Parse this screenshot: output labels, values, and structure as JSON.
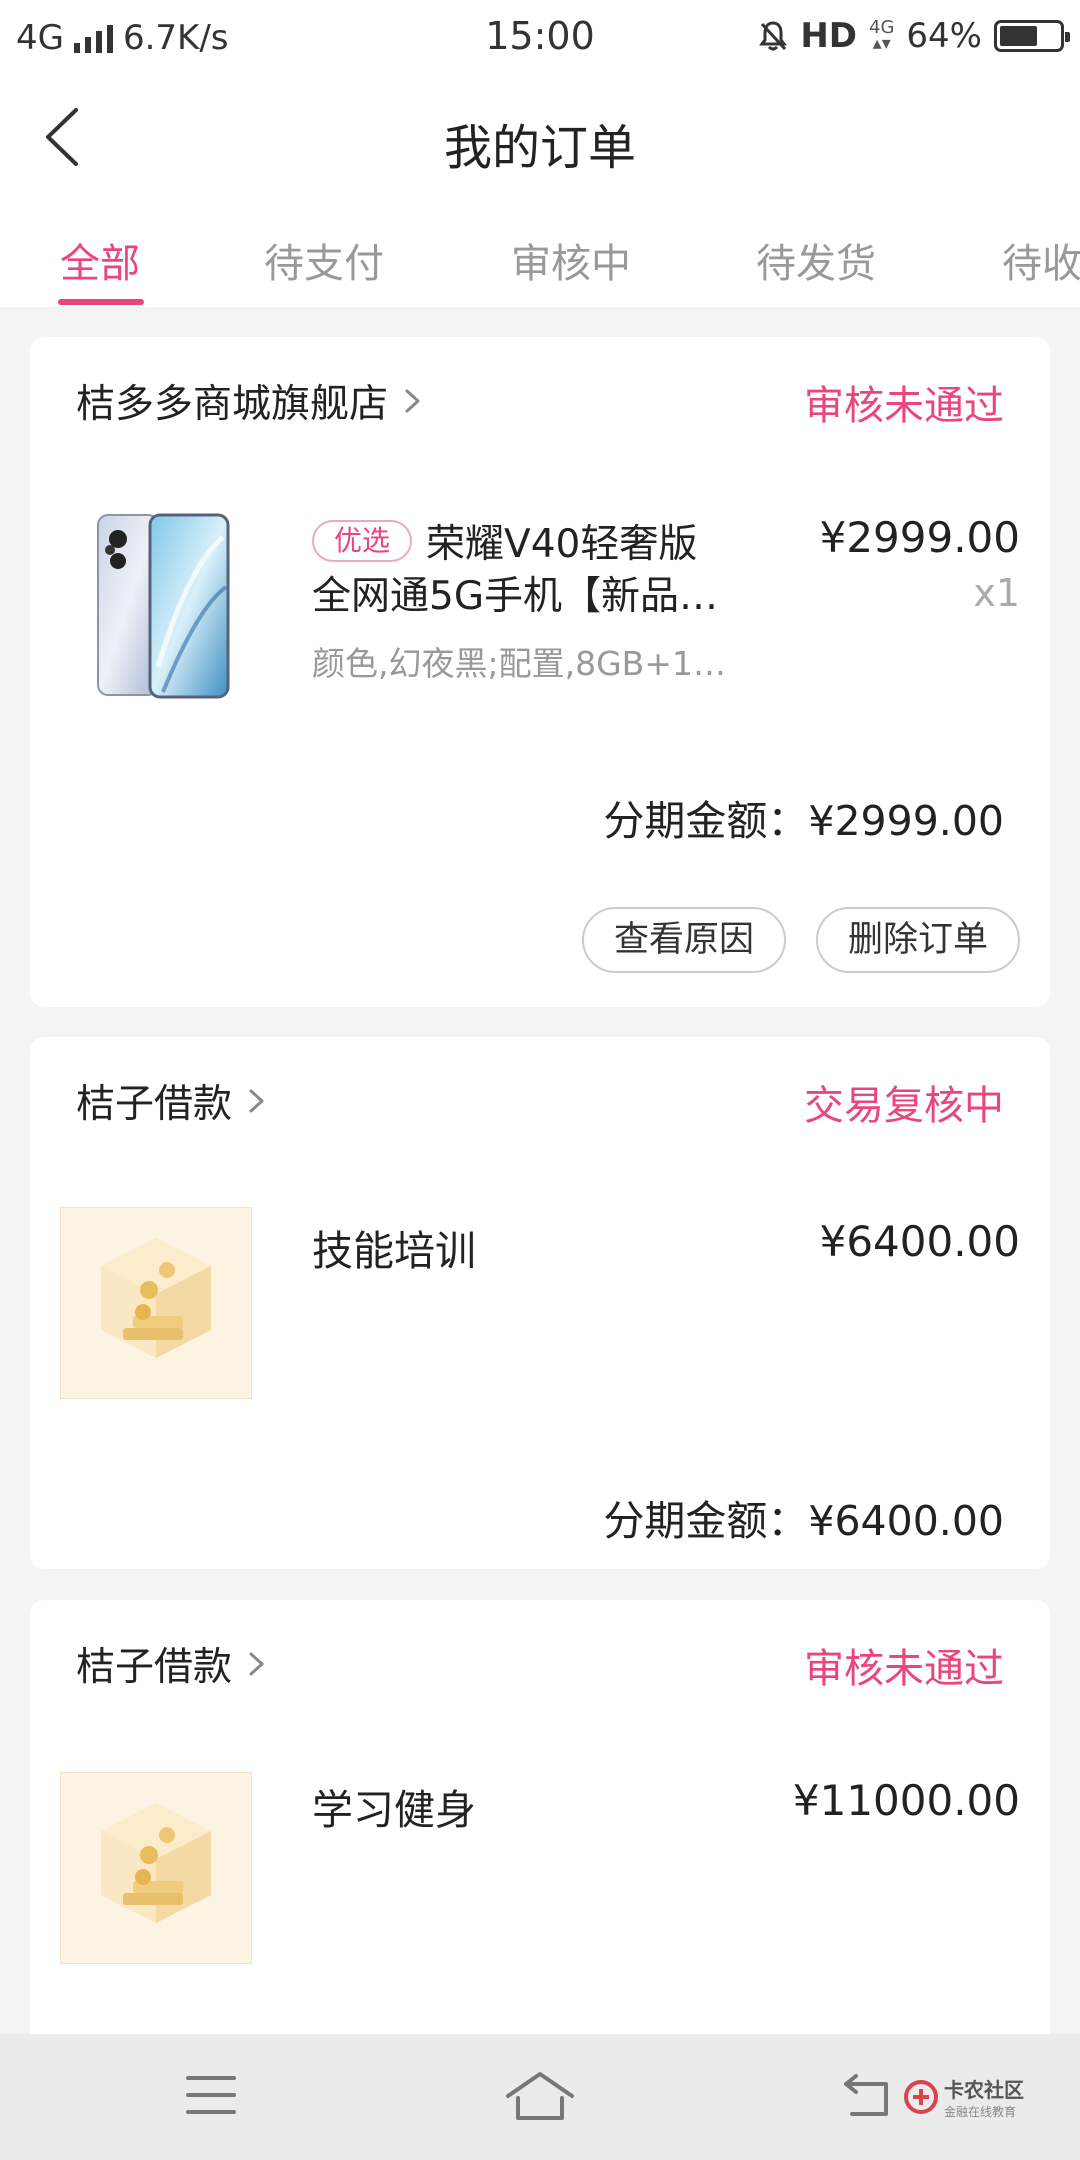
{
  "status_bar": {
    "network": "4G",
    "speed": "6.7K/s",
    "time": "15:00",
    "hd": "HD",
    "network_small": "4G",
    "battery_text": "64%",
    "battery_level": 0.64
  },
  "header": {
    "title": "我的订单"
  },
  "tabs": [
    {
      "label": "全部",
      "active": true
    },
    {
      "label": "待支付",
      "active": false
    },
    {
      "label": "审核中",
      "active": false
    },
    {
      "label": "待发货",
      "active": false
    },
    {
      "label": "待收货",
      "active": false
    }
  ],
  "orders": [
    {
      "store": "桔多多商城旗舰店",
      "status": "审核未通过",
      "badge": "优选",
      "title_line1": "荣耀V40轻奢版",
      "title_line2": "全网通5G手机【新品…",
      "spec": "颜色,幻夜黑;配置,8GB+1…",
      "price": "¥2999.00",
      "qty": "x1",
      "installment": "分期金额：¥2999.00",
      "buttons": [
        "查看原因",
        "删除订单"
      ]
    },
    {
      "store": "桔子借款",
      "status": "交易复核中",
      "item": "技能培训",
      "price": "¥6400.00",
      "installment": "分期金额：¥6400.00"
    },
    {
      "store": "桔子借款",
      "status": "审核未通过",
      "item": "学习健身",
      "price": "¥11000.00"
    }
  ],
  "watermark": {
    "top": "卡农社区",
    "bottom": "金融在线教育"
  },
  "colors": {
    "accent": "#e8467c",
    "muted": "#999999",
    "background": "#f4f4f4"
  }
}
